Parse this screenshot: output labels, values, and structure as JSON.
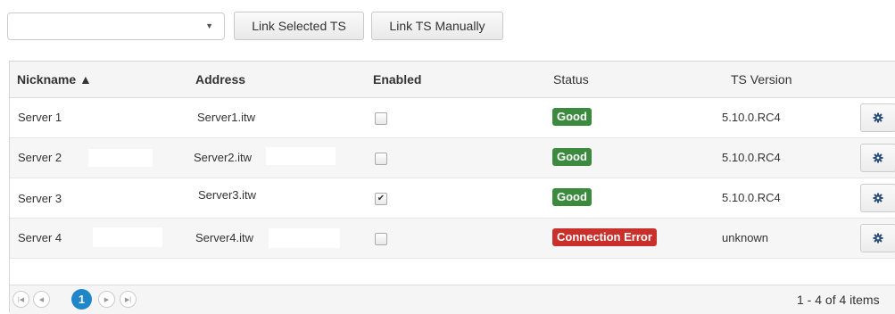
{
  "toolbar": {
    "select_value": "",
    "link_selected_label": "Link Selected TS",
    "link_manually_label": "Link TS Manually"
  },
  "columns": {
    "nickname": "Nickname ▲",
    "address": "Address",
    "enabled": "Enabled",
    "status": "Status",
    "version": "TS Version"
  },
  "rows": [
    {
      "nickname": "Server 1",
      "address": "Server1.itw",
      "enabled": false,
      "status": "Good",
      "version": "5.10.0.RC4"
    },
    {
      "nickname": "Server 2",
      "address": "Server2.itw",
      "enabled": false,
      "status": "Good",
      "version": "5.10.0.RC4"
    },
    {
      "nickname": "Server 3",
      "address": "Server3.itw",
      "enabled": true,
      "status": "Good",
      "version": "5.10.0.RC4"
    },
    {
      "nickname": "Server 4",
      "address": "Server4.itw",
      "enabled": false,
      "status": "Connection Error",
      "version": "unknown"
    }
  ],
  "status_colors": {
    "Good": "#3b8a3e",
    "Connection Error": "#c9302c"
  },
  "pager": {
    "current_page": "1",
    "info": "1 - 4 of 4 items"
  }
}
